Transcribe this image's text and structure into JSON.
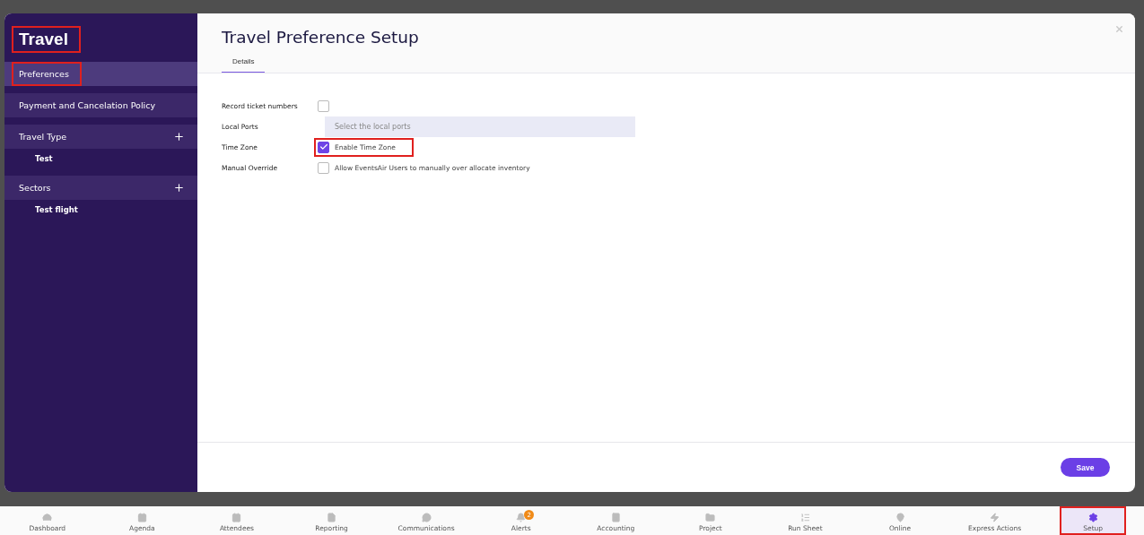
{
  "sidebar": {
    "title": "Travel",
    "title_highlighted": true,
    "sections": [
      {
        "label": "Preferences",
        "selected": true,
        "highlighted": true,
        "addable": false
      },
      {
        "label": "Payment and Cancelation Policy",
        "selected": false,
        "highlighted": false,
        "addable": false
      },
      {
        "label": "Travel Type",
        "selected": false,
        "highlighted": false,
        "addable": true,
        "children": [
          {
            "label": "Test"
          }
        ]
      },
      {
        "label": "Sectors",
        "selected": false,
        "highlighted": false,
        "addable": true,
        "children": [
          {
            "label": "Test flight"
          }
        ]
      }
    ]
  },
  "dialog": {
    "title": "Travel Preference Setup",
    "tabs": [
      {
        "label": "Details",
        "selected": true
      }
    ],
    "fields": [
      {
        "kind": "checkbox",
        "label": "Record ticket numbers",
        "checked": false,
        "highlighted": false
      },
      {
        "kind": "select",
        "label": "Local Ports",
        "placeholder": "Select the local ports"
      },
      {
        "kind": "checkbox",
        "label": "Time Zone",
        "checked": true,
        "option": "Enable Time Zone",
        "highlighted": true
      },
      {
        "kind": "checkbox",
        "label": "Manual Override",
        "checked": false,
        "option": "Allow EventsAir Users to manually over allocate inventory",
        "highlighted": false
      }
    ],
    "save_button": "Save"
  },
  "bottom_nav": [
    {
      "label": "Dashboard",
      "selected": false,
      "highlighted": false
    },
    {
      "label": "Agenda",
      "selected": false,
      "highlighted": false
    },
    {
      "label": "Attendees",
      "selected": false,
      "highlighted": false
    },
    {
      "label": "Reporting",
      "selected": false,
      "highlighted": false
    },
    {
      "label": "Communications",
      "selected": false,
      "highlighted": false
    },
    {
      "label": "Alerts",
      "selected": false,
      "highlighted": false,
      "badge": "2"
    },
    {
      "label": "Accounting",
      "selected": false,
      "highlighted": false
    },
    {
      "label": "Project",
      "selected": false,
      "highlighted": false
    },
    {
      "label": "Run Sheet",
      "selected": false,
      "highlighted": false
    },
    {
      "label": "Online",
      "selected": false,
      "highlighted": false
    },
    {
      "label": "Express Actions",
      "selected": false,
      "highlighted": false
    },
    {
      "label": "Setup",
      "selected": true,
      "highlighted": true
    }
  ]
}
